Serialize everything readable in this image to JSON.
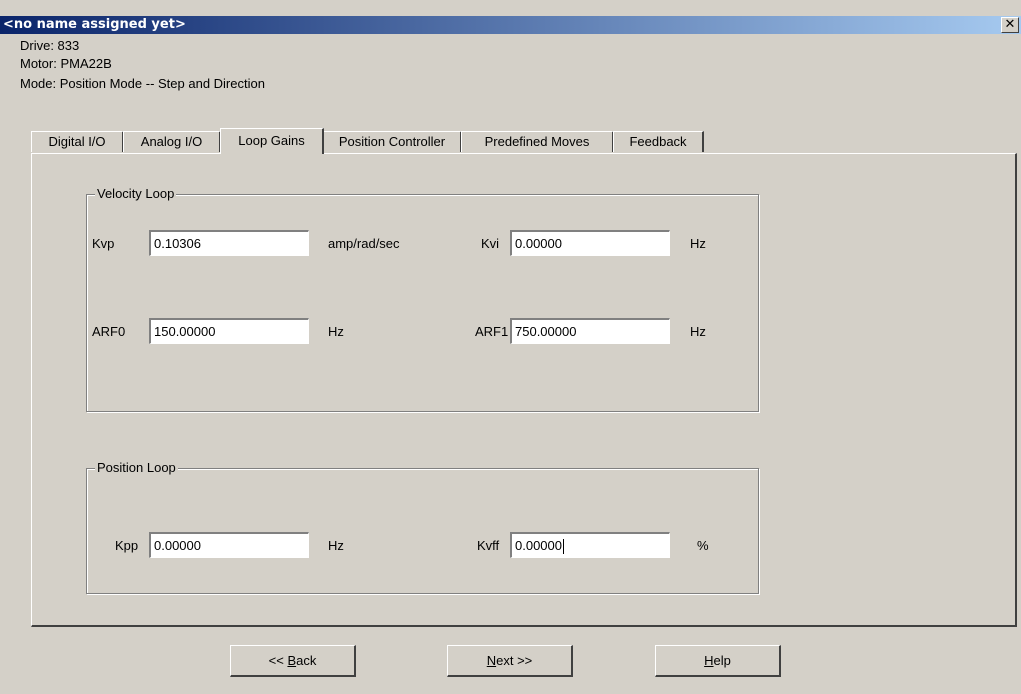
{
  "window": {
    "title": "<no name assigned yet>",
    "close_glyph": "✕"
  },
  "info": {
    "drive": "Drive: 833",
    "motor": "Motor: PMA22B",
    "mode": "Mode: Position Mode -- Step and Direction"
  },
  "tabs": [
    {
      "label": "Digital I/O",
      "active": false
    },
    {
      "label": "Analog I/O",
      "active": false
    },
    {
      "label": "Loop Gains",
      "active": true
    },
    {
      "label": "Position Controller",
      "active": false
    },
    {
      "label": "Predefined Moves",
      "active": false
    },
    {
      "label": "Feedback",
      "active": false
    }
  ],
  "velocity_loop": {
    "title": "Velocity Loop",
    "kvp": {
      "label": "Kvp",
      "value": "0.10306",
      "unit": "amp/rad/sec"
    },
    "kvi": {
      "label": "Kvi",
      "value": "0.00000",
      "unit": "Hz"
    },
    "arf0": {
      "label": "ARF0",
      "value": "150.00000",
      "unit": "Hz"
    },
    "arf1": {
      "label": "ARF1",
      "value": "750.00000",
      "unit": "Hz"
    }
  },
  "position_loop": {
    "title": "Position Loop",
    "kpp": {
      "label": "Kpp",
      "value": "0.00000",
      "unit": "Hz"
    },
    "kvff": {
      "label": "Kvff",
      "value": "0.00000",
      "unit": "%"
    }
  },
  "buttons": {
    "back_prefix": "<< ",
    "back_mnemonic": "B",
    "back_rest": "ack",
    "next_mnemonic": "N",
    "next_rest": "ext >>",
    "help_mnemonic": "H",
    "help_rest": "elp"
  }
}
